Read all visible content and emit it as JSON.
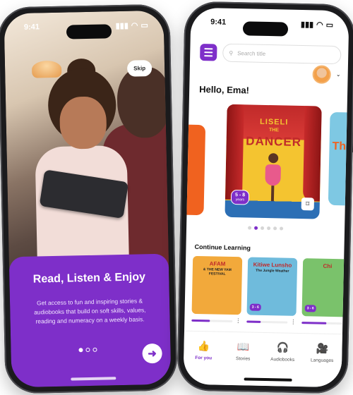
{
  "onboarding": {
    "status_time": "9:41",
    "skip_label": "Skip",
    "title": "Read, Listen & Enjoy",
    "description": "Get access to fun and inspiring stories & audiobooks that build on soft skills, values, reading and numeracy on a weekly basis.",
    "dots": 3,
    "active_dot": 0
  },
  "home": {
    "status_time": "9:41",
    "search_placeholder": "Search title",
    "greeting": "Hello, Ema!",
    "featured": {
      "title_line1": "LISELI",
      "title_line2": "THE",
      "title_line3": "DANCER",
      "age_range": "5 - 8",
      "age_unit": "years"
    },
    "right_peek_text": "Th P",
    "carousel_dots": 6,
    "carousel_active": 1,
    "continue_title": "Continue Learning",
    "continue_items": [
      {
        "title": "AFAM",
        "subtitle": "& THE NEW YAM FESTIVAL",
        "age": "",
        "progress": 0.45,
        "color": "#f2a93b"
      },
      {
        "title": "Kitiwe Lunsho",
        "subtitle": "The Jungle Weather",
        "age": "3 - 6",
        "progress": 0.35,
        "color": "#6fbbdc"
      },
      {
        "title": "Chi",
        "subtitle": "",
        "age": "3 - 6",
        "progress": 0.6,
        "color": "#7ac26b"
      }
    ],
    "tabs": [
      {
        "label": "For you",
        "icon": "thumbs-up-icon",
        "glyph": "👍",
        "active": true
      },
      {
        "label": "Stories",
        "icon": "book-icon",
        "glyph": "📖",
        "active": false
      },
      {
        "label": "Audiobooks",
        "icon": "headphones-icon",
        "glyph": "🎧",
        "active": false
      },
      {
        "label": "Languages",
        "icon": "video-icon",
        "glyph": "🎥",
        "active": false
      }
    ]
  },
  "colors": {
    "brand": "#7e2fc9",
    "accent_red": "#c02a2a",
    "accent_yellow": "#f4c430"
  }
}
